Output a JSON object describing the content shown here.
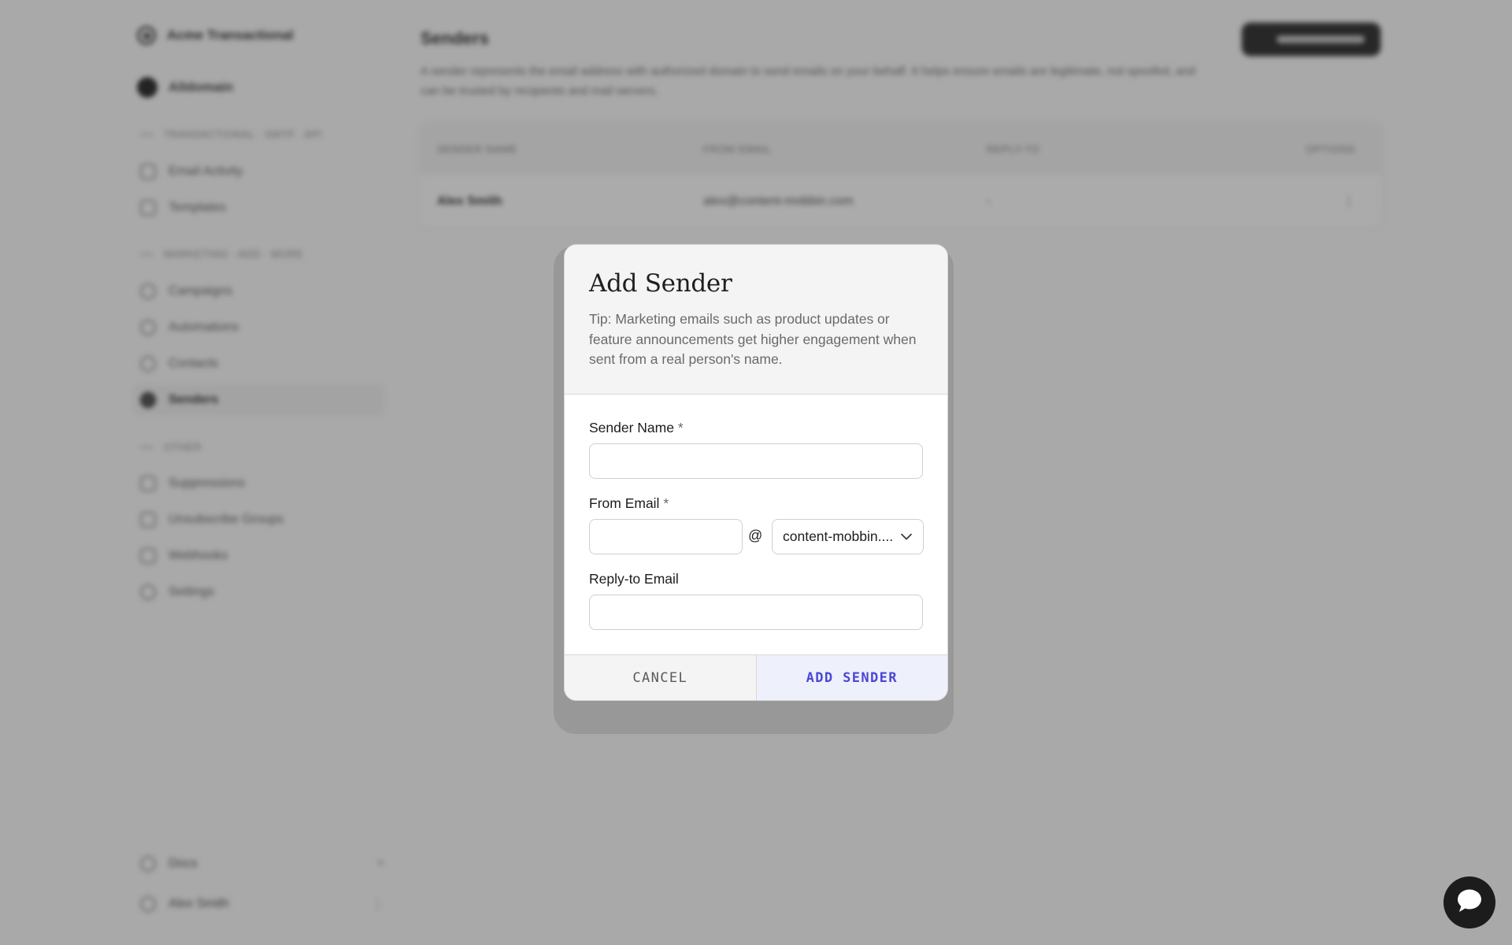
{
  "app": {
    "brand": "Acme Transactional",
    "workspace": "Alldomain"
  },
  "sidebar": {
    "sections": [
      {
        "label": "TRANSACTIONAL · SMTP · API"
      },
      {
        "label": "MARKETING · ADD · MORE"
      },
      {
        "label": "OTHER"
      }
    ],
    "items": [
      {
        "label": "Email Activity"
      },
      {
        "label": "Templates"
      },
      {
        "label": "Campaigns"
      },
      {
        "label": "Automations"
      },
      {
        "label": "Contacts"
      },
      {
        "label": "Senders"
      },
      {
        "label": "Suppressions"
      },
      {
        "label": "Unsubscribe Groups"
      },
      {
        "label": "Webhooks"
      },
      {
        "label": "Settings"
      }
    ],
    "bottom": [
      {
        "label": "Docs",
        "trail": "+"
      },
      {
        "label": "Alex Smith",
        "trail": "⋮"
      }
    ]
  },
  "main": {
    "title": "Senders",
    "description": "A sender represents the email address with authorized domain to send emails on your behalf. It helps ensure emails are legitimate, not spoofed, and can be trusted by recipients and mail servers.",
    "table": {
      "headers": [
        "SENDER NAME",
        "FROM EMAIL",
        "REPLY-TO",
        "OPTIONS"
      ],
      "rows": [
        {
          "name": "Alex Smith",
          "email": "alex@content-mobbin.com",
          "reply": "-",
          "options": "⋮"
        }
      ]
    }
  },
  "modal": {
    "title": "Add Sender",
    "tip": "Tip: Marketing emails such as product updates or feature announcements get higher engagement when sent from a real person's name.",
    "sender_name_label": "Sender Name",
    "from_email_label": "From Email",
    "required_mark": "*",
    "at_sign": "@",
    "domain_value": "content-mobbin....",
    "reply_to_label": "Reply-to Email",
    "sender_name_value": "",
    "from_email_value": "",
    "reply_to_value": "",
    "cancel_label": "CANCEL",
    "add_label": "ADD SENDER"
  },
  "colors": {
    "accent": "#4b47d6",
    "accent_bg": "#eef0fb",
    "overlay": "#9a9a9a",
    "chat_bg": "#1c1c1c"
  },
  "icons": {
    "chevron": "chevron-down-icon",
    "chat": "chat-bubble-icon"
  }
}
